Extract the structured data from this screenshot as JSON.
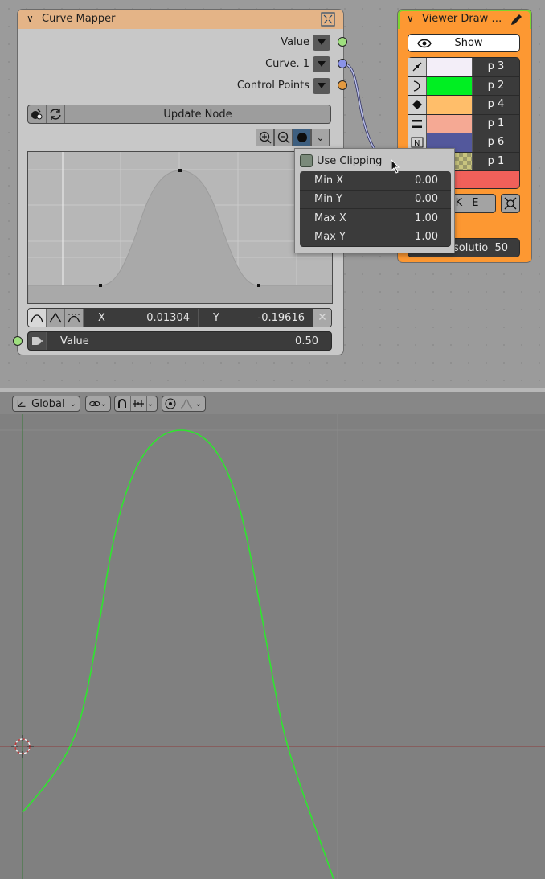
{
  "curve_mapper": {
    "title": "Curve Mapper",
    "outputs": [
      {
        "label": "Value",
        "socket_color": "#9fe07f"
      },
      {
        "label": "Curve. 1",
        "socket_color": "#8a93e8"
      },
      {
        "label": "Control Points",
        "socket_color": "#e39a41"
      }
    ],
    "update_label": "Update Node",
    "coord_x_label": "X",
    "coord_x_value": "0.01304",
    "coord_y_label": "Y",
    "coord_y_value": "-0.19616",
    "delete_glyph": "✕",
    "value_label": "Value",
    "value_value": "0.50",
    "value_socket_color": "#9fe07f"
  },
  "clipping_popup": {
    "use_clipping_label": "Use Clipping",
    "use_clipping_checked": false,
    "fields": [
      {
        "label": "Min X",
        "value": "0.00"
      },
      {
        "label": "Min Y",
        "value": "0.00"
      },
      {
        "label": "Max X",
        "value": "1.00"
      },
      {
        "label": "Max Y",
        "value": "1.00"
      }
    ]
  },
  "viewer_node": {
    "title": "Viewer Draw Curve",
    "show_label": "Show",
    "point_attrs": [
      {
        "label": "p 3",
        "color": "#f3eef8",
        "icon": "vertex-edge-icon"
      },
      {
        "label": "p 2",
        "color": "#00ef22",
        "icon": "curve-handle-icon"
      },
      {
        "label": "p 4",
        "color": "#ffbe6a",
        "icon": "diamond-icon"
      },
      {
        "label": "p 1",
        "color": "#f5a994",
        "icon": "lines-icon"
      },
      {
        "label": "p 6",
        "color": "#53589c",
        "icon": "normal-icon"
      },
      {
        "label": "p 1",
        "color": "#c8c47e",
        "icon": "vertex-edge-icon"
      }
    ],
    "bake_label": "B A K E",
    "resolution_label": "solutio",
    "resolution_value": "50",
    "accent_color": "#fd9832"
  },
  "viewport_header": {
    "orientation_label": "Global"
  },
  "colors": {
    "curve_green": "#2ee62e",
    "x_axis": "#8a4a4a",
    "y_axis": "#4a7a4a"
  }
}
